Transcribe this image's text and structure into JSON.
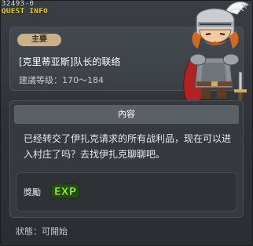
{
  "window": {
    "quest_id": "32493-0",
    "title": "QUEST INFO",
    "close_icon": "close-icon"
  },
  "quest": {
    "category_badge": "主要",
    "name": "[克里蒂亚斯]队长的联络",
    "level_range": "建議等级：170～184"
  },
  "content": {
    "tab_label": "內容",
    "description": "已经转交了伊扎克请求的所有战利品，现在可以进入村庄了吗？去找伊扎克聊聊吧。"
  },
  "reward": {
    "label": "獎勵",
    "exp_text": "EXP",
    "exp_icon": "exp-icon"
  },
  "status": {
    "text": "狀態：可開始"
  },
  "colors": {
    "title": "#f3d23a",
    "badge_bg": "#c9b189",
    "exp_green": "#7ee03a",
    "panel_bg": "#363a40"
  }
}
